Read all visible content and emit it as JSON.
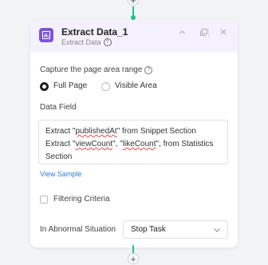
{
  "node": {
    "title": "Extract Data_1",
    "subtitle": "Extract Data",
    "icon": "data-table-icon",
    "accent_color": "#7a55d9"
  },
  "header_actions": [
    "chevron-up-icon",
    "copy-icon",
    "close-icon"
  ],
  "capture": {
    "label": "Capture the page area range",
    "options": [
      {
        "label": "Full Page",
        "selected": true
      },
      {
        "label": "Visible Area",
        "selected": false
      }
    ]
  },
  "data_field": {
    "label": "Data Field",
    "line1_a": "Extract \"",
    "line1_b": "publishedAt",
    "line1_c": "\" from Snippet Section",
    "line2_a": "Extract \"",
    "line2_b": "viewCount",
    "line2_c": "\", \"",
    "line2_d": "likeCount",
    "line2_e": "\", from Statistics",
    "line3": "Section"
  },
  "view_sample_label": "View Sample",
  "filtering": {
    "label": "Filtering Criteria",
    "checked": false
  },
  "abnormal": {
    "label": "In Abnormal Situation",
    "value": "Stop Task"
  },
  "connector_color": "#25c08a"
}
